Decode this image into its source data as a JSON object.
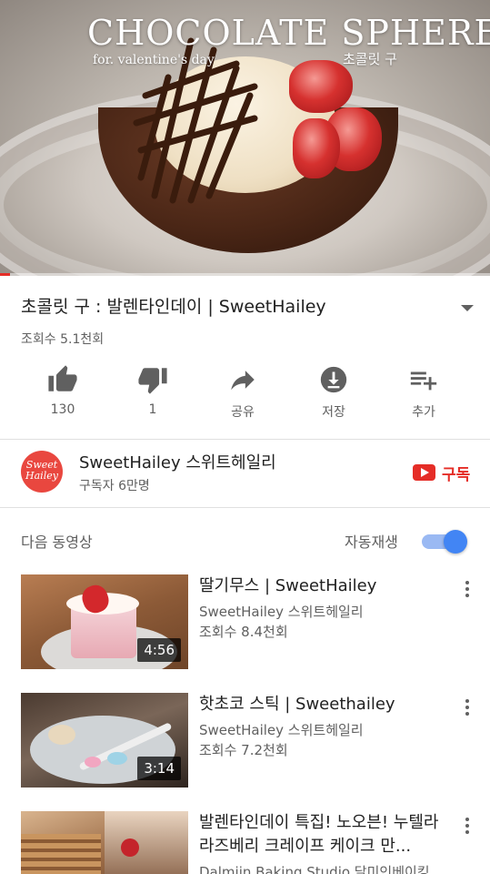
{
  "player": {
    "overlay_title": "CHOCOLATE SPHERE",
    "overlay_subtitle": "for. valentine's day",
    "overlay_korean": "초콜릿 구",
    "progress": 0.02
  },
  "video": {
    "title": "초콜릿 구 : 발렌타인데이 | SweetHailey",
    "views": "조회수 5.1천회"
  },
  "actions": [
    {
      "label": "130",
      "icon": "thumbs-up-icon"
    },
    {
      "label": "1",
      "icon": "thumbs-down-icon"
    },
    {
      "label": "공유",
      "icon": "share-icon"
    },
    {
      "label": "저장",
      "icon": "download-icon"
    },
    {
      "label": "추가",
      "icon": "add-to-playlist-icon"
    }
  ],
  "channel": {
    "name": "SweetHailey 스위트헤일리",
    "subscribers": "구독자 6만명",
    "avatar_text": "Sweet Hailey",
    "subscribe_label": "구독"
  },
  "up_next": {
    "label": "다음 동영상",
    "autoplay_label": "자동재생",
    "autoplay_on": true
  },
  "videos": [
    {
      "title": "딸기무스 | SweetHailey",
      "channel": "SweetHailey 스위트헤일리",
      "views": "조회수 8.4천회",
      "duration": "4:56"
    },
    {
      "title": "핫초코 스틱 | Sweethailey",
      "channel": "SweetHailey 스위트헤일리",
      "views": "조회수 7.2천회",
      "duration": "3:14"
    },
    {
      "title": "발렌타인데이 특집! 노오븐! 누텔라 라즈베리 크레이프 케이크 만...",
      "channel": "Dalmiin Baking Studio 달미인베이킹",
      "views": "",
      "duration": ""
    }
  ],
  "colors": {
    "accent_red": "#e52d27",
    "toggle_blue": "#4285f4"
  }
}
